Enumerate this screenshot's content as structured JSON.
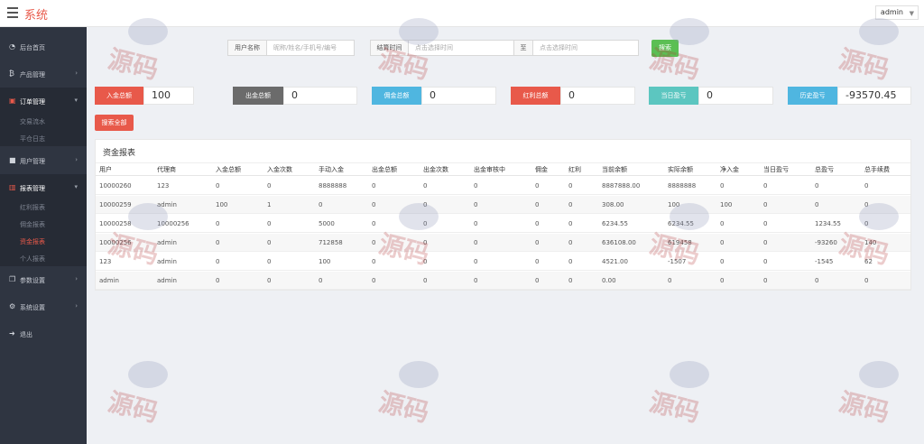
{
  "app": {
    "title": "系统",
    "user": "admin"
  },
  "sidebar": {
    "items": [
      {
        "label": "后台首页",
        "icon": "dashboard-icon"
      },
      {
        "label": "产品管理",
        "icon": "bitcoin-icon"
      },
      {
        "label": "订单管理",
        "icon": "document-icon",
        "sub": [
          "交易流水",
          "平仓日志"
        ]
      },
      {
        "label": "用户管理",
        "icon": "user-icon"
      },
      {
        "label": "报表管理",
        "icon": "bar-chart-icon",
        "sub": [
          "红利报表",
          "佣金报表",
          "资金报表",
          "个人报表"
        ]
      },
      {
        "label": "参数设置",
        "icon": "copy-icon"
      },
      {
        "label": "系统设置",
        "icon": "gears-icon"
      },
      {
        "label": "退出",
        "icon": "sign-out-icon"
      }
    ]
  },
  "filter": {
    "username_label": "用户名称",
    "username_placeholder": "昵称/姓名/手机号/编号",
    "settle_label": "结算时间",
    "start_placeholder": "点击选择时间",
    "to_label": "至",
    "end_placeholder": "点击选择时间",
    "search_label": "搜索"
  },
  "stats": [
    {
      "label": "入金总额",
      "value": "100",
      "color": "#e8594a"
    },
    {
      "label": "出金总额",
      "value": "0",
      "color": "#6b6b6b"
    },
    {
      "label": "佣金总额",
      "value": "0",
      "color": "#4fb6e0"
    },
    {
      "label": "红利总额",
      "value": "0",
      "color": "#e8594a"
    },
    {
      "label": "当日盈亏",
      "value": "0",
      "color": "#5cc6c0"
    },
    {
      "label": "历史盈亏",
      "value": "-93570.45",
      "color": "#4fb6e0"
    }
  ],
  "query_all_label": "搜索全部",
  "report": {
    "title": "资金报表",
    "columns": [
      "用户",
      "代理商",
      "入金总额",
      "入金次数",
      "手动入金",
      "出金总额",
      "出金次数",
      "出金审核中",
      "佣金",
      "红利",
      "当前余额",
      "实际余额",
      "净入金",
      "当日盈亏",
      "总盈亏",
      "总手续费"
    ],
    "rows": [
      [
        "10000260",
        "123",
        "0",
        "0",
        "8888888",
        "0",
        "0",
        "0",
        "0",
        "0",
        "8887888.00",
        "8888888",
        "0",
        "0",
        "0",
        "0"
      ],
      [
        "10000259",
        "admin",
        "100",
        "1",
        "0",
        "0",
        "0",
        "0",
        "0",
        "0",
        "308.00",
        "100",
        "100",
        "0",
        "0",
        "0"
      ],
      [
        "10000258",
        "10000256",
        "0",
        "0",
        "5000",
        "0",
        "0",
        "0",
        "0",
        "0",
        "6234.55",
        "6234.55",
        "0",
        "0",
        "1234.55",
        "0"
      ],
      [
        "10000256",
        "admin",
        "0",
        "0",
        "712858",
        "0",
        "0",
        "0",
        "0",
        "0",
        "636108.00",
        "619458",
        "0",
        "0",
        "-93260",
        "140"
      ],
      [
        "123",
        "admin",
        "0",
        "0",
        "100",
        "0",
        "0",
        "0",
        "0",
        "0",
        "4521.00",
        "-1507",
        "0",
        "0",
        "-1545",
        "62"
      ],
      [
        "admin",
        "admin",
        "0",
        "0",
        "0",
        "0",
        "0",
        "0",
        "0",
        "0",
        "0.00",
        "0",
        "0",
        "0",
        "0",
        "0"
      ]
    ]
  },
  "watermark": {
    "text": "源码"
  }
}
